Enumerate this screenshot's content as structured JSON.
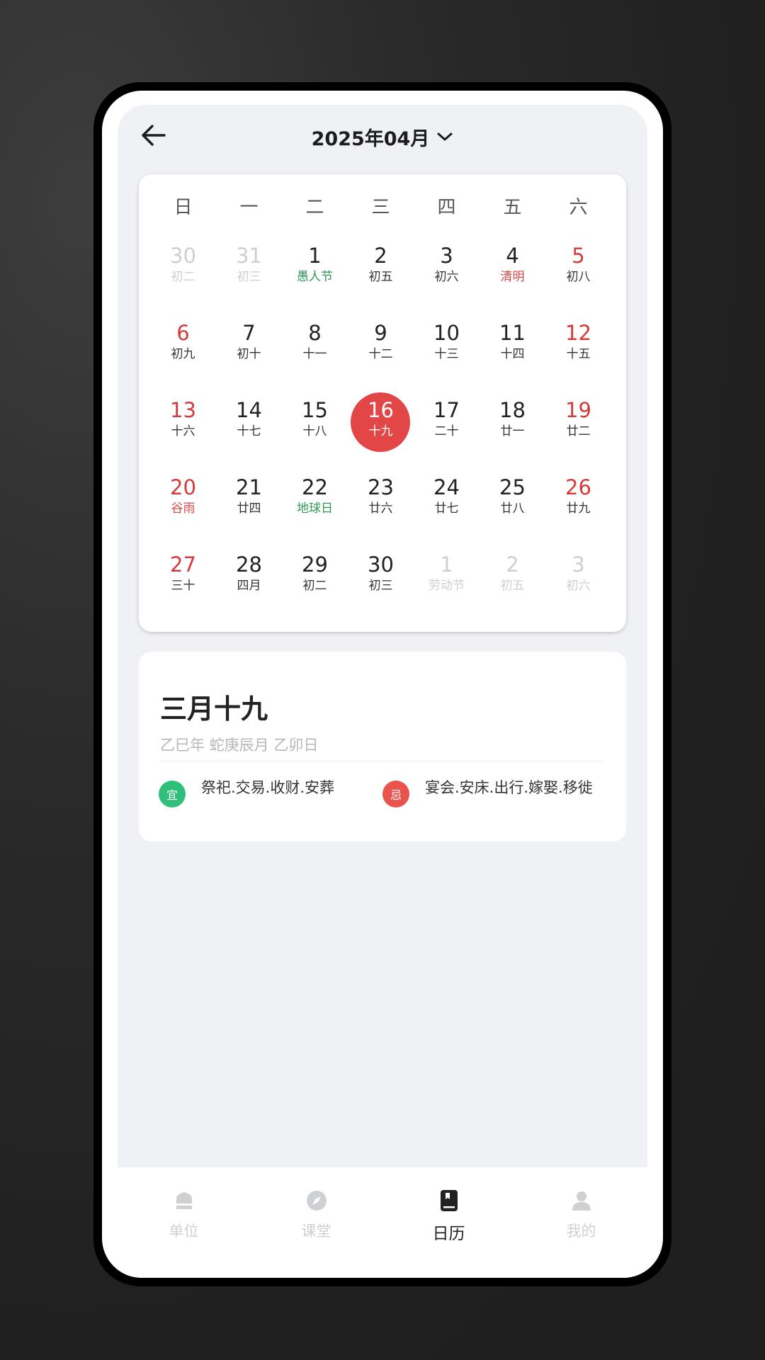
{
  "header": {
    "back_icon": "arrow-left-icon",
    "month": "2025年04月",
    "dropdown_icon": "chevron-down-icon"
  },
  "weekdays": [
    "日",
    "一",
    "二",
    "三",
    "四",
    "五",
    "六"
  ],
  "calendar": {
    "weeks": [
      [
        {
          "day": "30",
          "lunar": "初二",
          "type": "other"
        },
        {
          "day": "31",
          "lunar": "初三",
          "type": "other"
        },
        {
          "day": "1",
          "lunar": "愚人节",
          "type": "festival-green"
        },
        {
          "day": "2",
          "lunar": "初五",
          "type": "normal"
        },
        {
          "day": "3",
          "lunar": "初六",
          "type": "normal"
        },
        {
          "day": "4",
          "lunar": "清明",
          "type": "festival-red"
        },
        {
          "day": "5",
          "lunar": "初八",
          "type": "weekend"
        }
      ],
      [
        {
          "day": "6",
          "lunar": "初九",
          "type": "weekend"
        },
        {
          "day": "7",
          "lunar": "初十",
          "type": "normal"
        },
        {
          "day": "8",
          "lunar": "十一",
          "type": "normal"
        },
        {
          "day": "9",
          "lunar": "十二",
          "type": "normal"
        },
        {
          "day": "10",
          "lunar": "十三",
          "type": "normal"
        },
        {
          "day": "11",
          "lunar": "十四",
          "type": "normal"
        },
        {
          "day": "12",
          "lunar": "十五",
          "type": "weekend"
        }
      ],
      [
        {
          "day": "13",
          "lunar": "十六",
          "type": "weekend"
        },
        {
          "day": "14",
          "lunar": "十七",
          "type": "normal"
        },
        {
          "day": "15",
          "lunar": "十八",
          "type": "normal"
        },
        {
          "day": "16",
          "lunar": "十九",
          "type": "selected"
        },
        {
          "day": "17",
          "lunar": "二十",
          "type": "normal"
        },
        {
          "day": "18",
          "lunar": "廿一",
          "type": "normal"
        },
        {
          "day": "19",
          "lunar": "廿二",
          "type": "weekend"
        }
      ],
      [
        {
          "day": "20",
          "lunar": "谷雨",
          "type": "weekend festival-red"
        },
        {
          "day": "21",
          "lunar": "廿四",
          "type": "normal"
        },
        {
          "day": "22",
          "lunar": "地球日",
          "type": "festival-green"
        },
        {
          "day": "23",
          "lunar": "廿六",
          "type": "normal"
        },
        {
          "day": "24",
          "lunar": "廿七",
          "type": "normal"
        },
        {
          "day": "25",
          "lunar": "廿八",
          "type": "normal"
        },
        {
          "day": "26",
          "lunar": "廿九",
          "type": "weekend"
        }
      ],
      [
        {
          "day": "27",
          "lunar": "三十",
          "type": "weekend"
        },
        {
          "day": "28",
          "lunar": "四月",
          "type": "normal"
        },
        {
          "day": "29",
          "lunar": "初二",
          "type": "normal"
        },
        {
          "day": "30",
          "lunar": "初三",
          "type": "normal"
        },
        {
          "day": "1",
          "lunar": "劳动节",
          "type": "other"
        },
        {
          "day": "2",
          "lunar": "初五",
          "type": "other"
        },
        {
          "day": "3",
          "lunar": "初六",
          "type": "other"
        }
      ]
    ]
  },
  "detail": {
    "lunar_date": "三月十九",
    "ganzhi": "乙巳年 蛇庚辰月 乙卯日",
    "yi_badge": "宜",
    "yi_items": "祭祀.交易.收财.安葬",
    "ji_badge": "忌",
    "ji_items": "宴会.安床.出行.嫁娶.移徙"
  },
  "tabs": [
    {
      "label": "单位",
      "icon": "building-icon",
      "active": false
    },
    {
      "label": "课堂",
      "icon": "compass-icon",
      "active": false
    },
    {
      "label": "日历",
      "icon": "calendar-book-icon",
      "active": true
    },
    {
      "label": "我的",
      "icon": "user-icon",
      "active": false
    }
  ],
  "colors": {
    "accent_red": "#e34646",
    "festival_green": "#2d9a55",
    "yi_green": "#2fbf7a",
    "ji_red": "#e9534c"
  }
}
